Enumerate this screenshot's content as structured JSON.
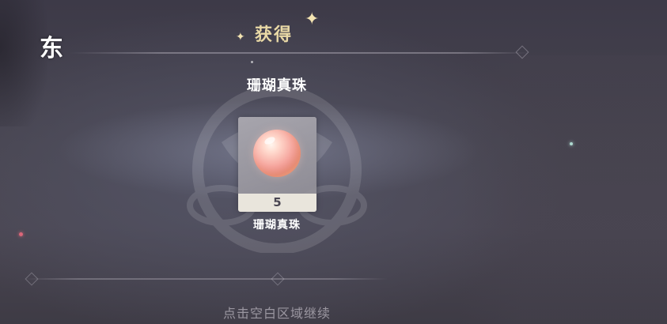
{
  "corner_label": "东",
  "reward": {
    "title": "获得",
    "item_title": "珊瑚真珠",
    "item": {
      "name": "珊瑚真珠",
      "count": "5",
      "icon": "coral-pearl-icon"
    },
    "continue_hint": "点击空白区域继续"
  },
  "colors": {
    "title_gold": "#e9d9a6",
    "card_strip": "#e9e5dc",
    "background": "#45424e"
  }
}
